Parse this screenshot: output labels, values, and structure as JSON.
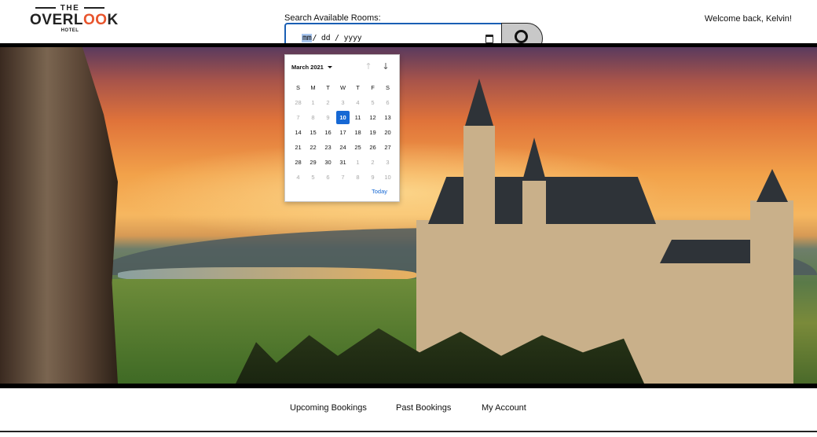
{
  "header": {
    "logo": {
      "the": "THE",
      "name_pre": "OVERL",
      "name_oo": "OO",
      "name_post": "K",
      "hotel": "HOTEL"
    },
    "search_label": "Search Available Rooms:",
    "date_input": {
      "mm": "mm",
      "rest": "/ dd / yyyy"
    },
    "welcome": "Welcome back, Kelvin!"
  },
  "calendar": {
    "month_label": "March 2021",
    "weekdays": [
      "S",
      "M",
      "T",
      "W",
      "T",
      "F",
      "S"
    ],
    "days": [
      {
        "d": "28",
        "muted": true
      },
      {
        "d": "1",
        "muted": true
      },
      {
        "d": "2",
        "muted": true
      },
      {
        "d": "3",
        "muted": true
      },
      {
        "d": "4",
        "muted": true
      },
      {
        "d": "5",
        "muted": true
      },
      {
        "d": "6",
        "muted": true
      },
      {
        "d": "7",
        "muted": true
      },
      {
        "d": "8",
        "muted": true
      },
      {
        "d": "9",
        "muted": true
      },
      {
        "d": "10",
        "selected": true
      },
      {
        "d": "11"
      },
      {
        "d": "12"
      },
      {
        "d": "13"
      },
      {
        "d": "14"
      },
      {
        "d": "15"
      },
      {
        "d": "16"
      },
      {
        "d": "17"
      },
      {
        "d": "18"
      },
      {
        "d": "19"
      },
      {
        "d": "20"
      },
      {
        "d": "21"
      },
      {
        "d": "22"
      },
      {
        "d": "23"
      },
      {
        "d": "24"
      },
      {
        "d": "25"
      },
      {
        "d": "26"
      },
      {
        "d": "27"
      },
      {
        "d": "28"
      },
      {
        "d": "29"
      },
      {
        "d": "30"
      },
      {
        "d": "31"
      },
      {
        "d": "1",
        "muted": true
      },
      {
        "d": "2",
        "muted": true
      },
      {
        "d": "3",
        "muted": true
      },
      {
        "d": "4",
        "muted": true
      },
      {
        "d": "5",
        "muted": true
      },
      {
        "d": "6",
        "muted": true
      },
      {
        "d": "7",
        "muted": true
      },
      {
        "d": "8",
        "muted": true
      },
      {
        "d": "9",
        "muted": true
      },
      {
        "d": "10",
        "muted": true
      }
    ],
    "today_label": "Today",
    "icons": {
      "prev": "arrow-up-icon",
      "next": "arrow-down-icon"
    }
  },
  "nav": {
    "upcoming": "Upcoming Bookings",
    "past": "Past Bookings",
    "account": "My Account"
  },
  "colors": {
    "accent": "#1668d4",
    "logo_orange": "#e8542c",
    "search_button": "#c8c8c8"
  }
}
